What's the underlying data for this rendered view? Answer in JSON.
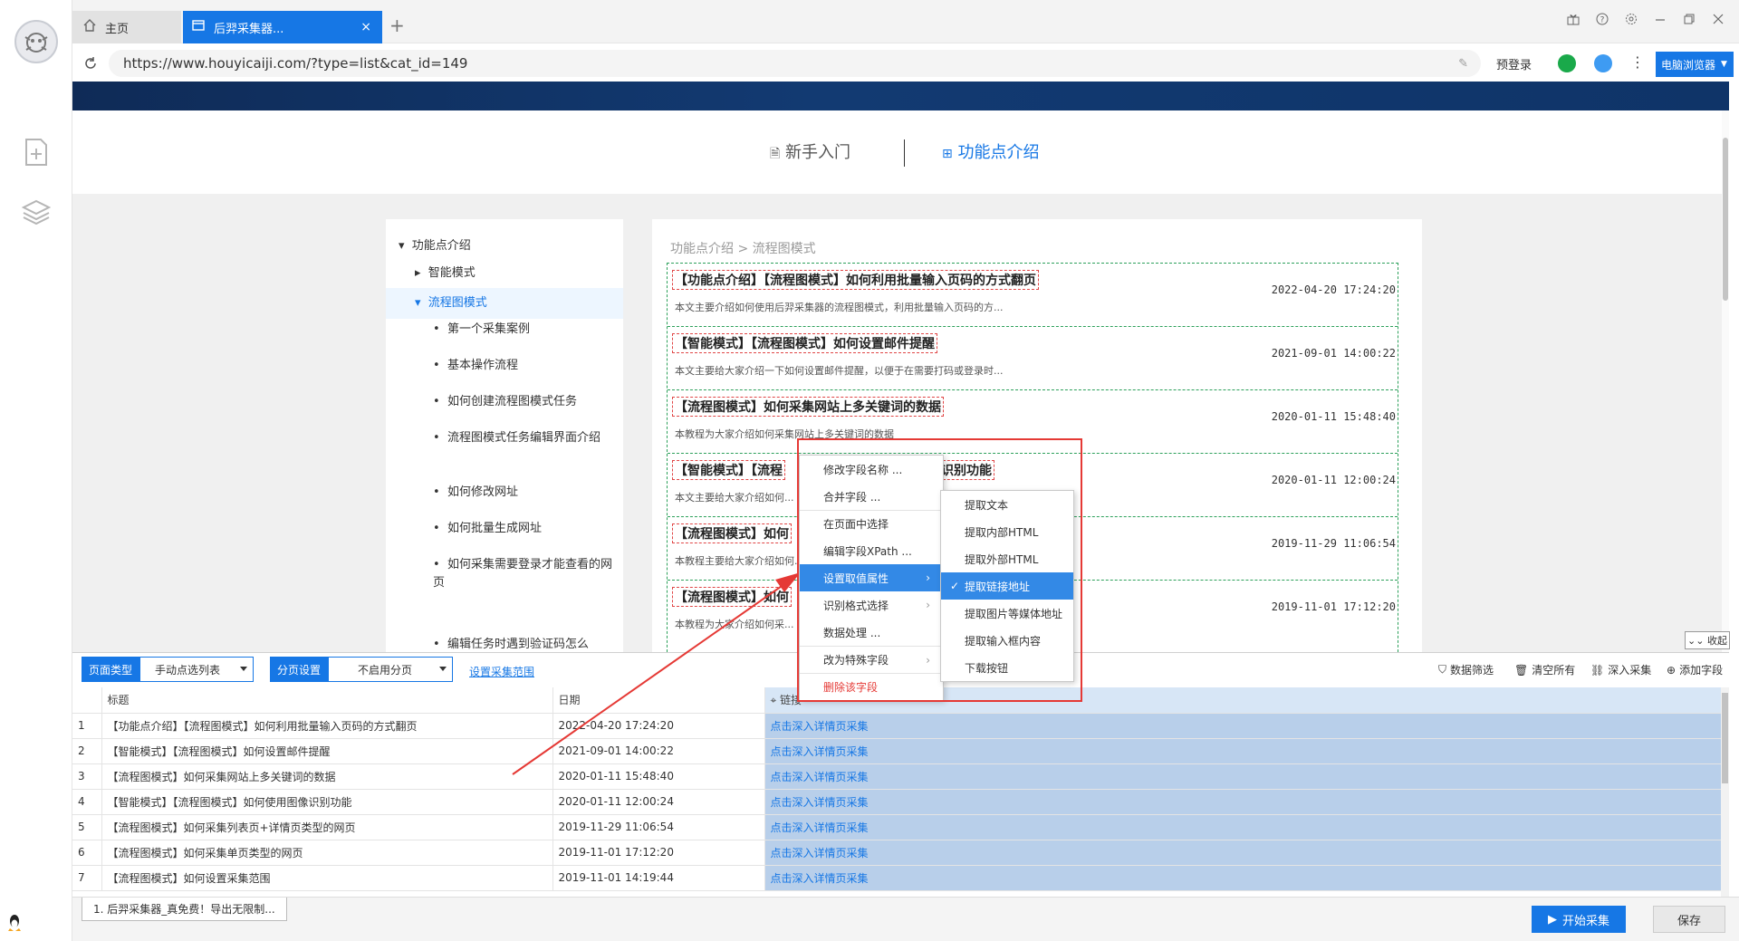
{
  "tabs": {
    "home_label": "主页",
    "active_label": "后羿采集器...",
    "close_glyph": "×",
    "new_tab_glyph": "+"
  },
  "address": {
    "url": "https://www.houyicaiji.com/?type=list&cat_id=149",
    "prelogin": "预登录",
    "browser_button": "电脑浏览器"
  },
  "site": {
    "nav_items": [
      "新手入门",
      "功能点介绍"
    ],
    "side_menu": [
      "功能点介绍",
      "智能模式",
      "流程图模式",
      "第一个采集案例",
      "基本操作流程",
      "如何创建流程图模式任务",
      "流程图模式任务编辑界面介绍",
      "如何修改网址",
      "如何批量生成网址",
      "如何采集需要登录才能查看的网页",
      "编辑任务时遇到验证码怎么"
    ],
    "breadcrumb": "功能点介绍 > 流程图模式",
    "articles": [
      {
        "title": "【功能点介绍】【流程图模式】如何利用批量输入页码的方式翻页",
        "date": "2022-04-20 17:24:20",
        "excerpt": "本文主要介绍如何使用后羿采集器的流程图模式，利用批量输入页码的方..."
      },
      {
        "title": "【智能模式】【流程图模式】如何设置邮件提醒",
        "date": "2021-09-01 14:00:22",
        "excerpt": "本文主要给大家介绍一下如何设置邮件提醒，以便于在需要打码或登录时..."
      },
      {
        "title": "【流程图模式】如何采集网站上多关键词的数据",
        "date": "2020-01-11 15:48:40",
        "excerpt": "本教程为大家介绍如何采集网站上多关键词的数据"
      },
      {
        "title": "【智能模式】【流程图模式】如何使用图像识别功能",
        "date": "2020-01-11 12:00:24",
        "excerpt": "本文主要给大家介绍如何..."
      },
      {
        "title": "【流程图模式】如何采集列表页+详情页类型的网页",
        "date": "2019-11-29 11:06:54",
        "excerpt": "本教程主要给大家介绍如何..."
      },
      {
        "title": "【流程图模式】如何采集单页类型的网页",
        "date": "2019-11-01 17:12:20",
        "excerpt": "本教程为大家介绍如何采..."
      }
    ],
    "art_visible_titles": [
      "【功能点介绍】【流程图模式】如何利用批量输入页码的方式翻页",
      "【智能模式】【流程图模式】如何设置邮件提醒",
      "【流程图模式】如何采集网站上多关键词的数据",
      "【智能模式】【流程",
      "【流程图模式】如何",
      "【流程图模式】如何"
    ],
    "art3_tail": "识别功能",
    "collapse_label": "收起"
  },
  "panel": {
    "page_type_label": "页面类型",
    "page_type_value": "手动点选列表",
    "paging_label": "分页设置",
    "paging_value": "不启用分页",
    "range_link": "设置采集范围",
    "right_tools": [
      "数据筛选",
      "清空所有",
      "深入采集",
      "添加字段"
    ],
    "columns": [
      "标题",
      "日期",
      "链接"
    ],
    "rows": [
      {
        "n": "1",
        "title": "【功能点介绍】【流程图模式】如何利用批量输入页码的方式翻页",
        "date": "2022-04-20 17:24:20",
        "link": "点击深入详情页采集"
      },
      {
        "n": "2",
        "title": "【智能模式】【流程图模式】如何设置邮件提醒",
        "date": "2021-09-01 14:00:22",
        "link": "点击深入详情页采集"
      },
      {
        "n": "3",
        "title": "【流程图模式】如何采集网站上多关键词的数据",
        "date": "2020-01-11 15:48:40",
        "link": "点击深入详情页采集"
      },
      {
        "n": "4",
        "title": "【智能模式】【流程图模式】如何使用图像识别功能",
        "date": "2020-01-11 12:00:24",
        "link": "点击深入详情页采集"
      },
      {
        "n": "5",
        "title": "【流程图模式】如何采集列表页+详情页类型的网页",
        "date": "2019-11-29 11:06:54",
        "link": "点击深入详情页采集"
      },
      {
        "n": "6",
        "title": "【流程图模式】如何采集单页类型的网页",
        "date": "2019-11-01 17:12:20",
        "link": "点击深入详情页采集"
      },
      {
        "n": "7",
        "title": "【流程图模式】如何设置采集范围",
        "date": "2019-11-01 14:19:44",
        "link": "点击深入详情页采集"
      }
    ]
  },
  "context_menu": {
    "items": [
      "修改字段名称 ...",
      "合并字段 ...",
      "在页面中选择",
      "编辑字段XPath ...",
      "设置取值属性",
      "识别格式选择",
      "数据处理 ...",
      "改为特殊字段",
      "删除该字段"
    ],
    "highlighted": "设置取值属性"
  },
  "submenu": {
    "items": [
      "提取文本",
      "提取内部HTML",
      "提取外部HTML",
      "提取链接地址",
      "提取图片等媒体地址",
      "提取输入框内容",
      "下载按钮"
    ],
    "checked": "提取链接地址"
  },
  "status": {
    "message": "1. 后羿采集器_真免费！导出无限制...",
    "start_button": "开始采集",
    "save_button": "保存"
  },
  "colors": {
    "accent": "#1677e5",
    "annotation_red": "#e53935",
    "dashed_green": "#2ca05a",
    "link_cell_bg": "#b8cfea"
  }
}
